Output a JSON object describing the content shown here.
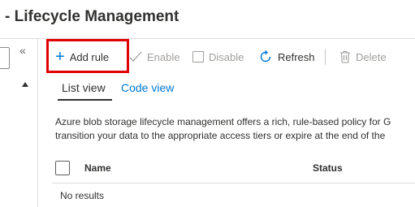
{
  "page": {
    "title": "- Lifecycle Management"
  },
  "toolbar": {
    "add_rule": "Add rule",
    "enable": "Enable",
    "disable": "Disable",
    "refresh": "Refresh",
    "delete": "Delete"
  },
  "tabs": [
    {
      "label": "List view",
      "active": true
    },
    {
      "label": "Code view",
      "active": false
    }
  ],
  "description": {
    "line1": "Azure blob storage lifecycle management offers a rich, rule-based policy for G",
    "line2": "transition your data to the appropriate access tiers or expire at the end of the"
  },
  "table": {
    "columns": [
      "Name",
      "Status"
    ],
    "empty_message": "No results"
  },
  "colors": {
    "accent": "#0078d4",
    "highlight_box": "#e00000",
    "disabled_text": "#a19f9d"
  },
  "icons": [
    "collapse-chevrons-icon",
    "plus-icon",
    "checkmark-icon",
    "checkbox-icon",
    "refresh-icon",
    "trash-icon",
    "scroll-up-icon"
  ]
}
